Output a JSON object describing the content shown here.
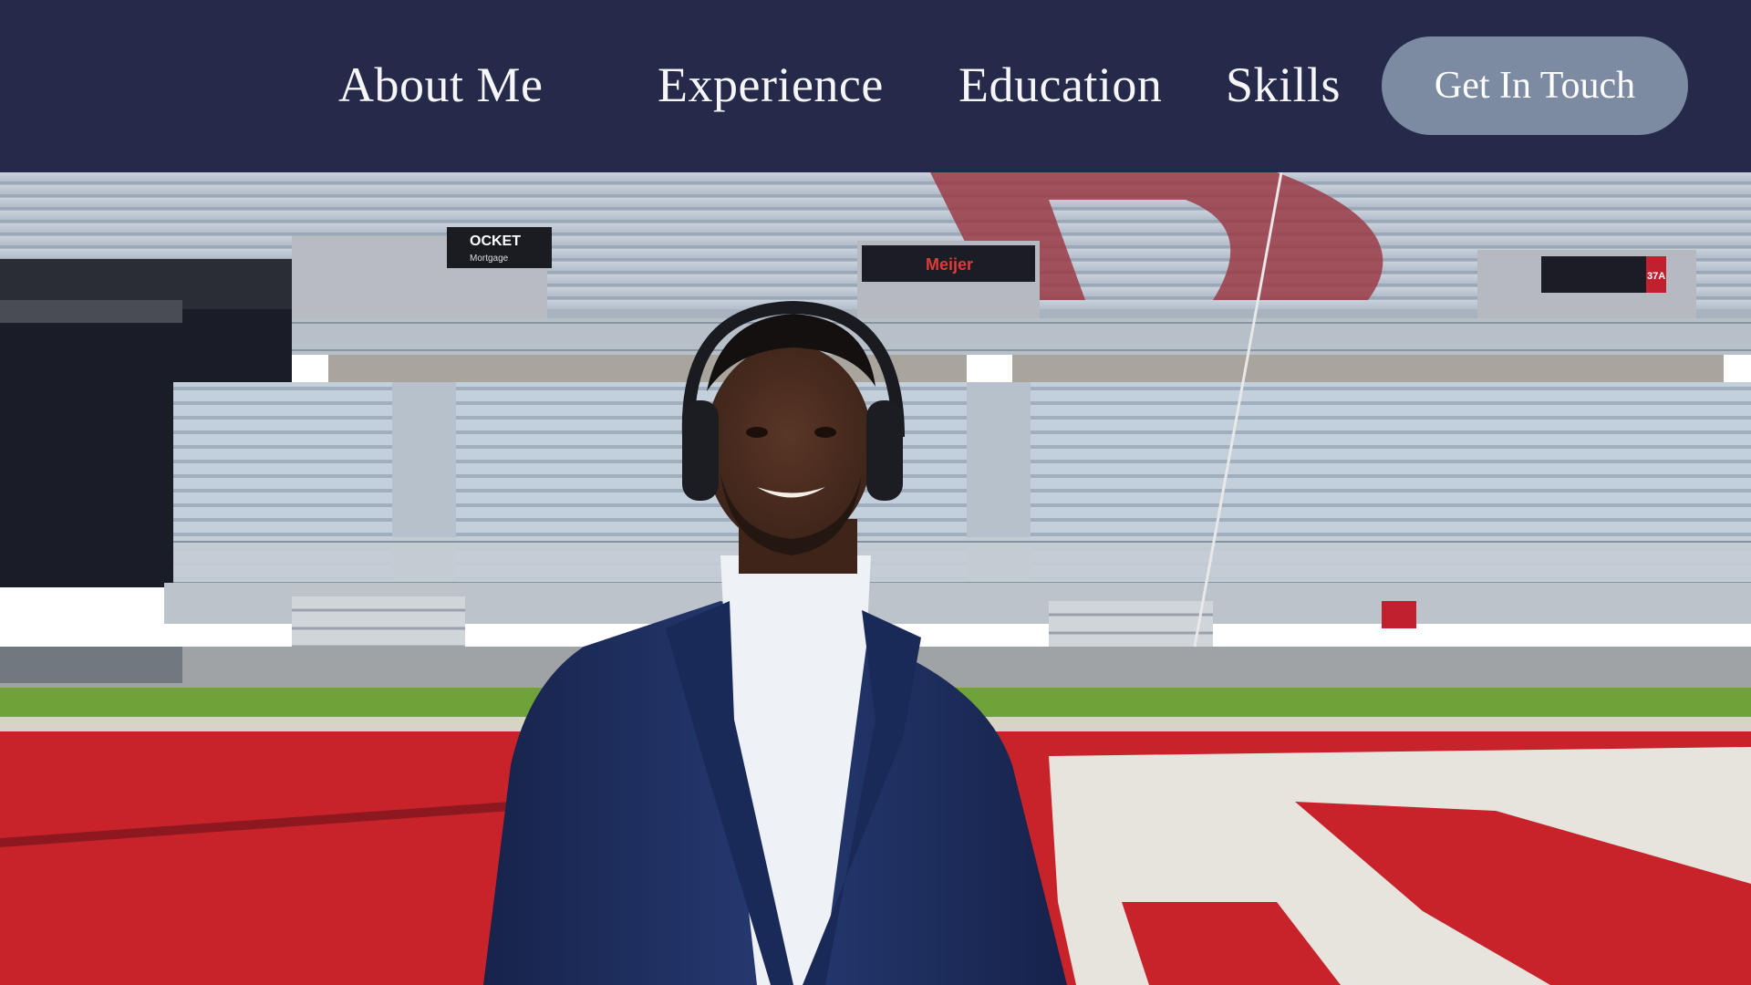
{
  "nav": {
    "items": [
      {
        "label": "About Me"
      },
      {
        "label": "Experience"
      },
      {
        "label": "Education"
      },
      {
        "label": "Skills"
      }
    ],
    "cta_label": "Get In Touch"
  },
  "colors": {
    "header_bg": "#252a4a",
    "cta_bg": "#7c8ba2",
    "nav_text": "#f6f6f8",
    "field_red": "#c8222b",
    "turf_green": "#6fa33a",
    "seat_gray": "#b9c4cf",
    "jacket_navy": "#1e2d5a"
  },
  "hero": {
    "image_description": "man-in-navy-blazer-with-headphones-in-football-stadium",
    "stadium_signs": [
      {
        "text": "OCKET"
      },
      {
        "text": "Mortgage"
      },
      {
        "text": "Meijer"
      },
      {
        "text": "37A"
      }
    ]
  }
}
